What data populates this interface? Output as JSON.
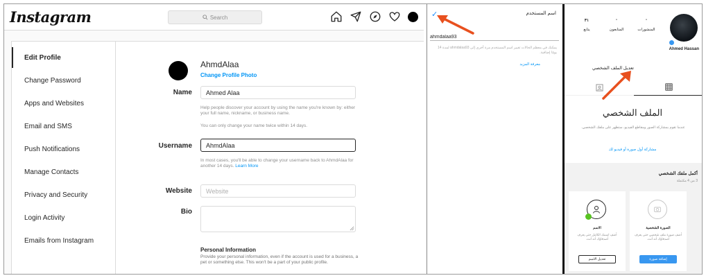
{
  "colors": {
    "accent": "#0095f6",
    "annotation_arrow": "#e8501e",
    "success": "#58c322"
  },
  "desktop": {
    "logo": "Instagram",
    "search": {
      "placeholder": "Search"
    },
    "nav_icons": [
      "home-icon",
      "direct-icon",
      "explore-icon",
      "activity-heart-icon",
      "avatar"
    ],
    "sidebar": [
      {
        "label": "Edit Profile",
        "active": true
      },
      {
        "label": "Change Password"
      },
      {
        "label": "Apps and Websites"
      },
      {
        "label": "Email and SMS"
      },
      {
        "label": "Push Notifications"
      },
      {
        "label": "Manage Contacts"
      },
      {
        "label": "Privacy and Security"
      },
      {
        "label": "Login Activity"
      },
      {
        "label": "Emails from Instagram"
      }
    ],
    "profile": {
      "username": "AhmdAlaa",
      "change_photo": "Change Profile Photo"
    },
    "form": {
      "name_label": "Name",
      "name_value": "Ahmed Alaa",
      "name_help_1": "Help people discover your account by using the name you're known by: either your full name, nickname, or business name.",
      "name_help_2": "You can only change your name twice within 14 days.",
      "username_label": "Username",
      "username_value": "AhmdAlaa",
      "username_help": "In most cases, you'll be able to change your username back to AhmdAlaa for another 14 days.",
      "username_help_link": "Learn More",
      "website_label": "Website",
      "website_placeholder": "Website",
      "bio_label": "Bio",
      "personal_info_title": "Personal Information",
      "personal_info_text": "Provide your personal information, even if the account is used for a business, a pet or something else. This won't be a part of your public profile."
    }
  },
  "mobile_username": {
    "title": "اسم المستخدم",
    "value": "ahmdalaa93",
    "help": "يمكنك في معظم الحالات تغيير اسم المستخدم مرة أخرى إلى ahmdalaa93 لمدة 14 يومًا إضافية.",
    "link": "معرفة المزيد"
  },
  "mobile_profile": {
    "stats": [
      {
        "count": "-",
        "label": "المنشورات"
      },
      {
        "count": "-",
        "label": "المتابعون"
      },
      {
        "count": "٣١",
        "label": "يتابع"
      }
    ],
    "name": "Ahmed Hassan",
    "edit_button": "تعديل الملف الشخصي",
    "tabs": [
      "grid-icon",
      "tagged-icon"
    ],
    "heading": "الملف الشخصي",
    "subtext": "عندما تقوم بمشاركة الصور ومقاطع الفيديو، ستظهر على ملفك الشخصي.",
    "share_link": "مشاركة أول صورة أو فيديو لك",
    "complete_title": "أكمل ملفك الشخصي",
    "complete_sub": "3 من 4 مكتملة",
    "cards": [
      {
        "title": "الصورة الشخصية",
        "desc": "أضف صورة ملف شخصي حتى يعرف أصدقاؤك أنه أنت.",
        "button": "إضافة صورة",
        "done": false
      },
      {
        "title": "الاسم",
        "desc": "أضف اسمك الكامل حتى يعرف أصدقاؤك أنه أنت.",
        "button": "تعديل الاسم",
        "done": true
      }
    ]
  }
}
